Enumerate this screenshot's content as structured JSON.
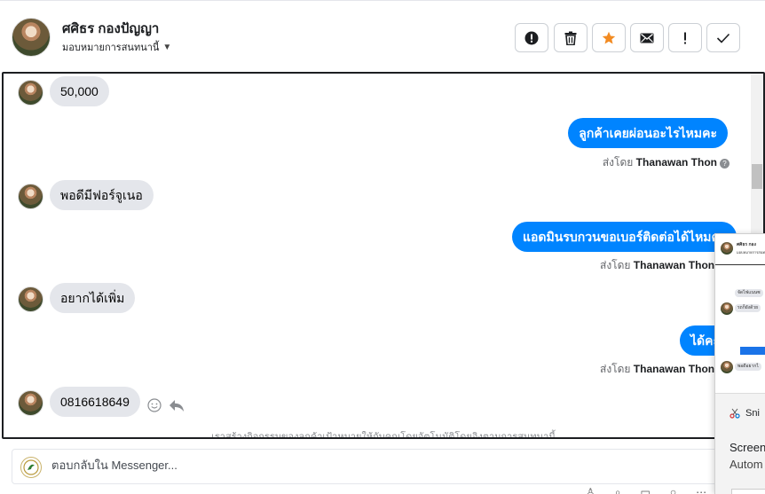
{
  "header": {
    "contact_name": "ศศิธร กองปัญญา",
    "assign_label": "มอบหมายการสนทนานี้"
  },
  "actions": [
    {
      "name": "spam-button",
      "icon": "alert-circle-icon"
    },
    {
      "name": "delete-button",
      "icon": "trash-icon"
    },
    {
      "name": "star-button",
      "icon": "star-icon",
      "color": "#f28b22"
    },
    {
      "name": "email-button",
      "icon": "envelope-icon"
    },
    {
      "name": "follow-up-button",
      "icon": "exclamation-icon"
    },
    {
      "name": "done-button",
      "icon": "checkmark-icon"
    }
  ],
  "messages": [
    {
      "dir": "in",
      "text": "50,000"
    },
    {
      "dir": "out",
      "text": "ลูกค้าเคยผ่อนอะไรไหมคะ",
      "sent_by_prefix": "ส่งโดย",
      "sent_by": "Thanawan Thon"
    },
    {
      "dir": "in",
      "text": "พอดีมีฟอร์จูเนอ"
    },
    {
      "dir": "out",
      "text": "แอดมินรบกวนขอเบอร์ติดต่อได้ไหมคะ",
      "sent_by_prefix": "ส่งโดย",
      "sent_by": "Thanawan Thon"
    },
    {
      "dir": "in",
      "text": "อยากได้เพิ่ม"
    },
    {
      "dir": "out",
      "text": "ได้คะ",
      "sent_by_prefix": "ส่งโดย",
      "sent_by": "Thanawan Thon"
    },
    {
      "dir": "in",
      "text": "0816618649"
    }
  ],
  "footer_note": "เราสร้างกิจกรรมของลูกค้าเป้าหมายให้กับคุณโดยอัตโนมัติโดยอิงตามการสนทนานี้",
  "reply": {
    "placeholder": "ตอบกลับใน Messenger..."
  },
  "overlay": {
    "app_name": "Sni",
    "line1": "Screen",
    "line2": "Autom",
    "thumb_name": "ศศิธร กอง",
    "thumb_msgs": [
      "จัดไฟแนนซ",
      "รถก็ยังด้วย",
      "พอดีอยากไ"
    ]
  },
  "colors": {
    "messenger_blue": "#0084ff",
    "incoming_bubble": "#e4e6eb",
    "star_orange": "#f28b22"
  }
}
